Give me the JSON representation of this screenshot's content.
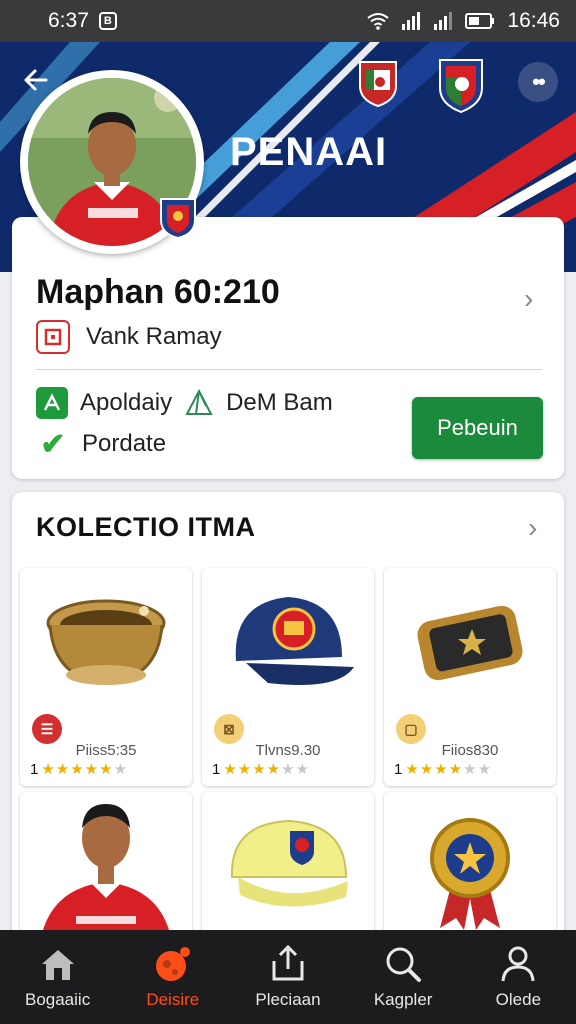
{
  "status_bar": {
    "time": "6:37",
    "clock": "16:46",
    "app_icon": "B"
  },
  "header": {
    "title": "PENAAI",
    "back_icon": "back-arrow-icon",
    "more_icon": "more-dots-icon",
    "colors": {
      "navy": "#0f2a6b",
      "red": "#d71f26",
      "light_blue": "#4fb3ea"
    }
  },
  "profile": {
    "name": "Maphan 60:210",
    "club": "Vank Ramay",
    "info_1": "Apoldaiy",
    "info_2": "DeM Bam",
    "info_3": "Pordate",
    "action_label": "Pebeuin",
    "accent": "#1b8a3a"
  },
  "collection": {
    "title": "KOLECTIO ITMA",
    "items": [
      {
        "image": "brass-bowl",
        "price": "Piiss5:35",
        "count": "1",
        "rating": 4.5,
        "tag_color": "#d32f2f"
      },
      {
        "image": "navy-cap",
        "price": "Tlvns9.30",
        "count": "1",
        "rating": 3.5,
        "tag_color": "#f3cf77"
      },
      {
        "image": "leather-strap",
        "price": "Fiios830",
        "count": "1",
        "rating": 3.5,
        "tag_color": "#f3cf77"
      },
      {
        "image": "player-photo",
        "price": "",
        "count": "",
        "rating": 0,
        "tag_color": ""
      },
      {
        "image": "yellow-cap",
        "price": "",
        "count": "",
        "rating": 0,
        "tag_color": ""
      },
      {
        "image": "gold-medal",
        "price": "",
        "count": "",
        "rating": 0,
        "tag_color": ""
      }
    ]
  },
  "nav": {
    "items": [
      {
        "label": "Bogaaiic",
        "icon": "home-icon"
      },
      {
        "label": "Deisire",
        "icon": "ball-icon"
      },
      {
        "label": "Pleciaan",
        "icon": "upload-icon"
      },
      {
        "label": "Kagpler",
        "icon": "search-icon"
      },
      {
        "label": "Olede",
        "icon": "profile-icon"
      }
    ],
    "active_index": 1,
    "active_color": "#ff4d1a"
  }
}
